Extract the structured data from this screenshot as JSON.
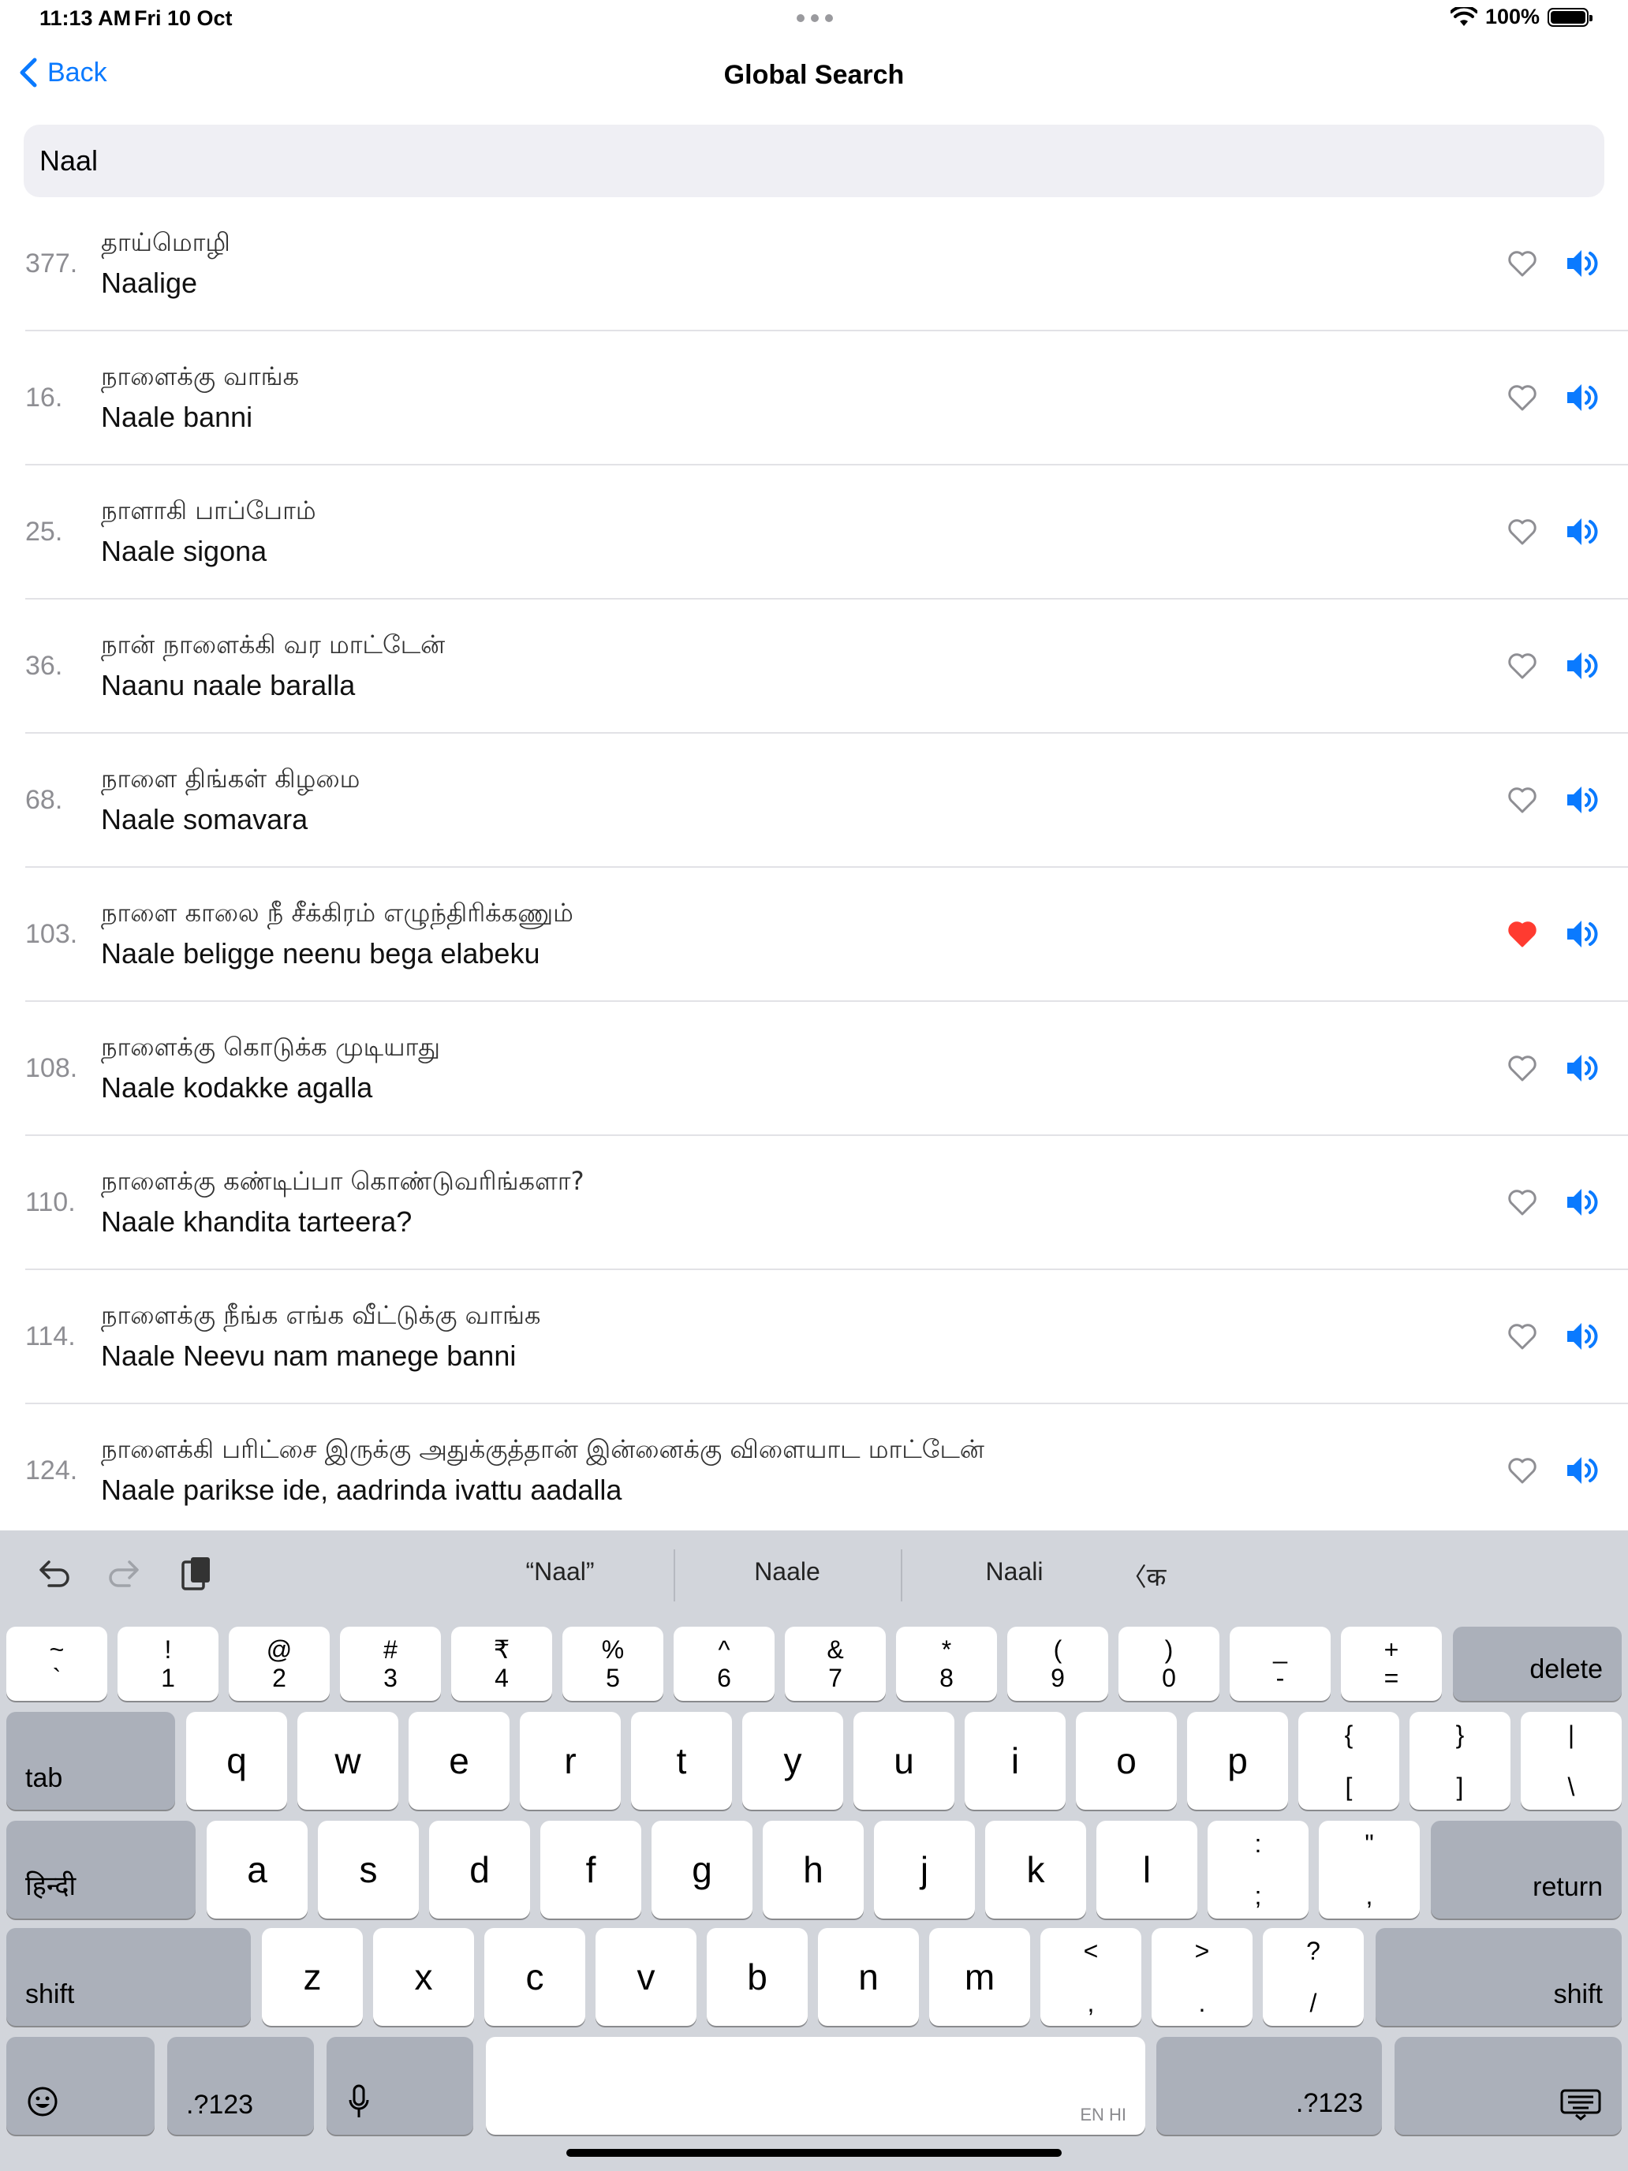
{
  "status": {
    "time": "11:13 AM",
    "date": "Fri 10 Oct",
    "battery": "100%",
    "icons": [
      "wifi-icon",
      "battery-icon"
    ]
  },
  "nav": {
    "back_label": "Back",
    "title": "Global Search"
  },
  "search": {
    "value": "Naal"
  },
  "colors": {
    "accent": "#0a7aff",
    "favorite": "#ff3b30",
    "separator": "#e2e2e6",
    "keyboard_bg": "#d2d5db"
  },
  "results": [
    {
      "num": "377.",
      "tamil": "தாய்மொழி",
      "latin": "Naalige",
      "favorite": false
    },
    {
      "num": "16.",
      "tamil": "நாளைக்கு வாங்க",
      "latin": "Naale banni",
      "favorite": false
    },
    {
      "num": "25.",
      "tamil": "நாளாகி பாப்போம்",
      "latin": "Naale sigona",
      "favorite": false
    },
    {
      "num": "36.",
      "tamil": "நான் நாளைக்கி வர மாட்டேன்",
      "latin": "Naanu naale baralla",
      "favorite": false
    },
    {
      "num": "68.",
      "tamil": "நாளை திங்கள் கிழமை",
      "latin": "Naale somavara",
      "favorite": false
    },
    {
      "num": "103.",
      "tamil": "நாளை காலை நீ சீக்கிரம் எழுந்திரிக்கணும்",
      "latin": "Naale beligge neenu bega elabeku",
      "favorite": true
    },
    {
      "num": "108.",
      "tamil": "நாளைக்கு கொடுக்க முடியாது",
      "latin": "Naale kodakke agalla",
      "favorite": false
    },
    {
      "num": "110.",
      "tamil": "நாளைக்கு கண்டிப்பா கொண்டுவரிங்களா?",
      "latin": "Naale khandita tarteera?",
      "favorite": false
    },
    {
      "num": "114.",
      "tamil": "நாளைக்கு நீங்க எங்க வீட்டுக்கு வாங்க",
      "latin": "Naale Neevu nam manege banni",
      "favorite": false
    },
    {
      "num": "124.",
      "tamil": "நாளைக்கி பரிட்சை இருக்கு அதுக்குத்தான் இன்னைக்கு விளையாட மாட்டேன்",
      "latin": "Naale parikse ide, aadrinda ivattu aadalla",
      "favorite": false
    }
  ],
  "keyboard": {
    "suggestions": [
      "“Naal”",
      "Naale",
      "Naali"
    ],
    "suggest_extra": "〈क",
    "number_row": [
      {
        "top": "~",
        "bottom": "`"
      },
      {
        "top": "!",
        "bottom": "1"
      },
      {
        "top": "@",
        "bottom": "2"
      },
      {
        "top": "#",
        "bottom": "3"
      },
      {
        "top": "₹",
        "bottom": "4"
      },
      {
        "top": "%",
        "bottom": "5"
      },
      {
        "top": "^",
        "bottom": "6"
      },
      {
        "top": "&",
        "bottom": "7"
      },
      {
        "top": "*",
        "bottom": "8"
      },
      {
        "top": "(",
        "bottom": "9"
      },
      {
        "top": ")",
        "bottom": "0"
      },
      {
        "top": "_",
        "bottom": "-"
      },
      {
        "top": "+",
        "bottom": "="
      }
    ],
    "delete": "delete",
    "tab": "tab",
    "row_q": [
      "q",
      "w",
      "e",
      "r",
      "t",
      "y",
      "u",
      "i",
      "o",
      "p"
    ],
    "row_q_extra": [
      {
        "top": "{",
        "bottom": "["
      },
      {
        "top": "}",
        "bottom": "]"
      },
      {
        "top": "|",
        "bottom": "\\"
      }
    ],
    "lang": "हिन्दी",
    "row_a": [
      "a",
      "s",
      "d",
      "f",
      "g",
      "h",
      "j",
      "k",
      "l"
    ],
    "row_a_extra": [
      {
        "top": ":",
        "bottom": ";"
      },
      {
        "top": "\"",
        "bottom": ","
      }
    ],
    "return": "return",
    "shift": "shift",
    "row_z": [
      "z",
      "x",
      "c",
      "v",
      "b",
      "n",
      "m"
    ],
    "row_z_extra": [
      {
        "top": "<",
        "bottom": ","
      },
      {
        "top": ">",
        "bottom": "."
      },
      {
        "top": "?",
        "bottom": "/"
      }
    ],
    "numbers": ".?123",
    "space_hint": "EN HI"
  }
}
